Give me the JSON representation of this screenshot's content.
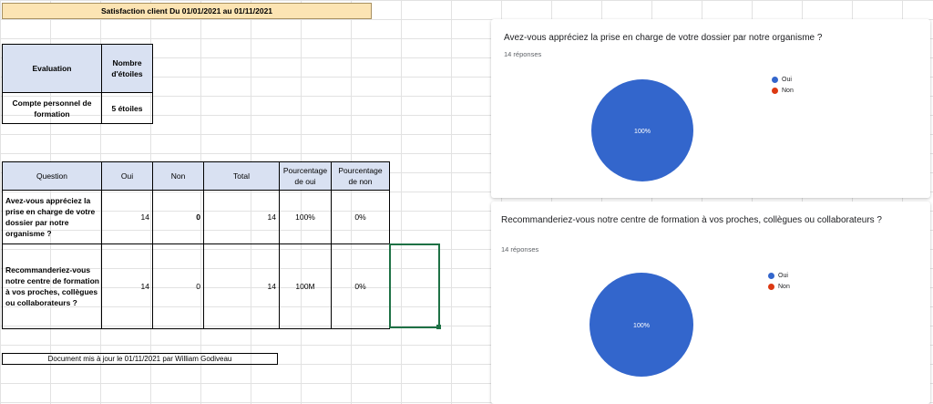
{
  "sheet": {
    "title": "Satisfaction client Du 01/01/2021 au 01/11/2021",
    "eval_table": {
      "headers": [
        "Evaluation",
        "Nombre d'étoiles"
      ],
      "row": [
        "Compte personnel de formation",
        "5 étoiles"
      ]
    },
    "question_table": {
      "headers": [
        "Question",
        "Oui",
        "Non",
        "Total",
        "Pourcentage de oui",
        "Pourcentage de non"
      ],
      "rows": [
        {
          "question": "Avez-vous appréciez la prise en charge de votre dossier par notre organisme ?",
          "oui": "14",
          "non": "0",
          "total": "14",
          "pct_oui": "100%",
          "pct_non": "0%"
        },
        {
          "question": "Recommanderiez-vous notre centre de formation à vos proches, collègues ou collaborateurs ?",
          "oui": "14",
          "non": "0",
          "total": "14",
          "pct_oui": "100M",
          "pct_non": "0%"
        }
      ]
    },
    "footer": "Document mis à jour le 01/11/2021 par William Godiveau"
  },
  "forms": [
    {
      "question": "Avez-vous appréciez la prise en charge de votre dossier par notre organisme ?",
      "responses": "14 réponses",
      "slice_label": "100%",
      "legend": [
        "Oui",
        "Non"
      ]
    },
    {
      "question": "Recommanderiez-vous notre centre de formation à vos proches, collègues ou collaborateurs ?",
      "responses": "14 réponses",
      "slice_label": "100%",
      "legend": [
        "Oui",
        "Non"
      ]
    }
  ],
  "chart_data": [
    {
      "type": "pie",
      "categories": [
        "Oui",
        "Non"
      ],
      "values": [
        100,
        0
      ],
      "colors": [
        "#3366cc",
        "#dc3912"
      ],
      "title": "Avez-vous appréciez la prise en charge de votre dossier par notre organisme ?"
    },
    {
      "type": "pie",
      "categories": [
        "Oui",
        "Non"
      ],
      "values": [
        100,
        0
      ],
      "colors": [
        "#3366cc",
        "#dc3912"
      ],
      "title": "Recommanderiez-vous notre centre de formation à vos proches, collègues ou collaborateurs ?"
    }
  ],
  "colors": {
    "oui": "#3366cc",
    "non": "#dc3912",
    "header_bg": "#d9e1f2",
    "title_bg": "#fce4b3",
    "selection": "#1e7145"
  }
}
